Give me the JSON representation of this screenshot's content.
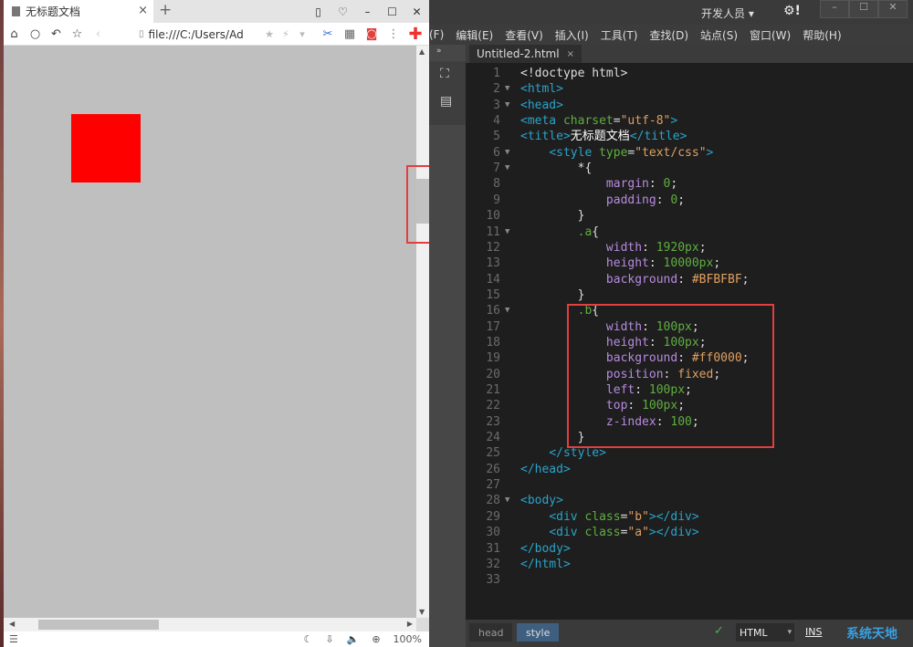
{
  "browser": {
    "tab_title": "无标题文档",
    "url": "file:///C:/Users/Ad",
    "zoom": "100%",
    "page_colors": {
      "background": "#BFBFBF",
      "box": "#ff0000"
    }
  },
  "editor": {
    "role_label": "开发人员",
    "menu": [
      "(F)",
      "编辑(E)",
      "查看(V)",
      "插入(I)",
      "工具(T)",
      "查找(D)",
      "站点(S)",
      "窗口(W)",
      "帮助(H)"
    ],
    "doc_tab": "Untitled-2.html",
    "breadcrumbs": [
      "head",
      "style"
    ],
    "language": "HTML",
    "mode": "INS",
    "watermark": "系统天地"
  }
}
